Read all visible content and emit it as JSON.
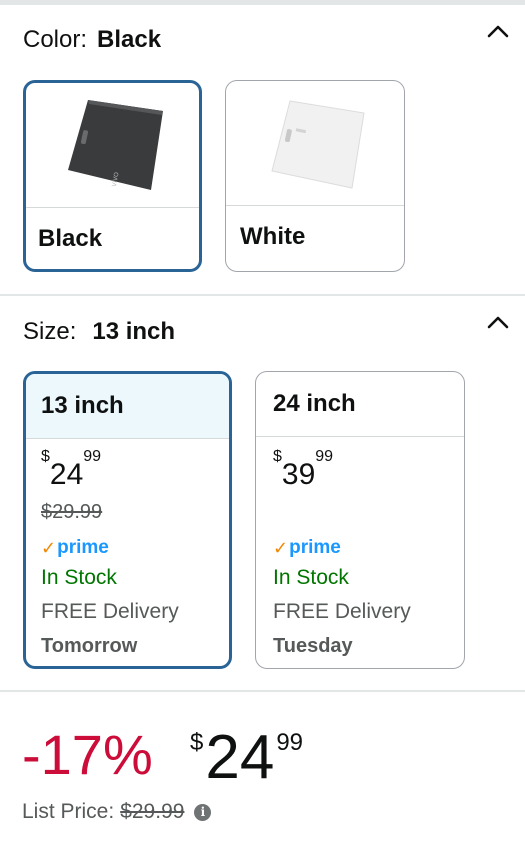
{
  "color_section": {
    "label": "Color:",
    "selected_value": "Black",
    "options": [
      {
        "label": "Black",
        "selected": true
      },
      {
        "label": "White",
        "selected": false
      }
    ]
  },
  "size_section": {
    "label": "Size:",
    "selected_value": "13 inch",
    "options": [
      {
        "label": "13 inch",
        "currency": "$",
        "price_whole": "24",
        "price_cents": "99",
        "was_price": "$29.99",
        "prime": "prime",
        "stock": "In Stock",
        "delivery": "FREE Delivery",
        "delivery_day": "Tomorrow",
        "selected": true
      },
      {
        "label": "24 inch",
        "currency": "$",
        "price_whole": "39",
        "price_cents": "99",
        "prime": "prime",
        "stock": "In Stock",
        "delivery": "FREE Delivery",
        "delivery_day": "Tuesday",
        "selected": false
      }
    ]
  },
  "summary": {
    "discount": "-17%",
    "currency": "$",
    "price_whole": "24",
    "price_cents": "99",
    "list_price_label": "List Price:",
    "list_price_value": "$29.99"
  },
  "colors": {
    "selected_border": "#2a6496",
    "discount": "#cc0c39",
    "in_stock": "#007600",
    "prime_blue": "#1a98ff",
    "prime_check": "#f08804"
  }
}
